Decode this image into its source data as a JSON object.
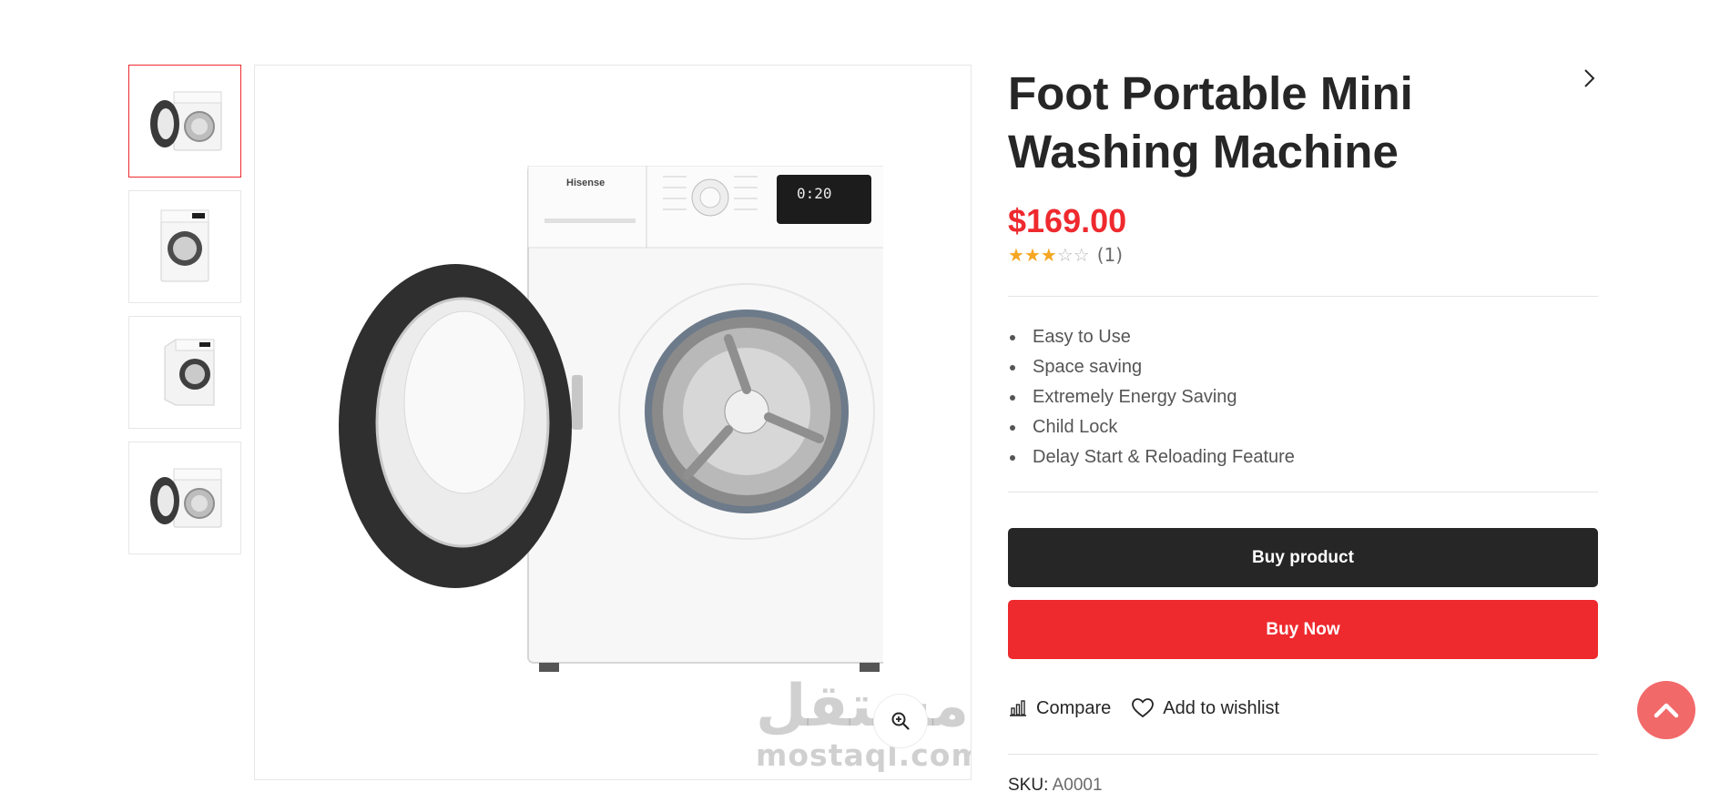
{
  "product": {
    "title": "Foot Portable Mini Washing Machine",
    "price": "$169.00",
    "rating": {
      "stars_filled": 3,
      "stars_total": 5,
      "count_label": "(1)"
    },
    "features": [
      "Easy to Use",
      "Space saving",
      "Extremely Energy Saving",
      "Child Lock",
      "Delay Start & Reloading Feature"
    ],
    "sku_label": "SKU:",
    "sku_value": "A0001"
  },
  "buttons": {
    "buy_product": "Buy product",
    "buy_now": "Buy Now"
  },
  "actions": {
    "compare": "Compare",
    "wishlist": "Add to wishlist"
  },
  "gallery": {
    "thumbnails": [
      {
        "view": "door-open-front",
        "active": true
      },
      {
        "view": "front-closed",
        "active": false
      },
      {
        "view": "angled-closed",
        "active": false
      },
      {
        "view": "door-open-front",
        "active": false
      }
    ],
    "main_image": {
      "brand_text": "Hisense",
      "display_text": "0:20"
    }
  },
  "watermark": {
    "arabic": "مستقل",
    "latin": "mostaql.com"
  },
  "icons": {
    "next": "chevron-right-icon",
    "zoom": "zoom-in-icon",
    "compare": "bar-chart-icon",
    "wishlist": "heart-icon",
    "scroll_top": "chevron-up-icon"
  },
  "colors": {
    "accent": "#ee2a2e",
    "dark_button": "#262626",
    "star": "#f5a623",
    "scroll_top": "#f2696a"
  }
}
